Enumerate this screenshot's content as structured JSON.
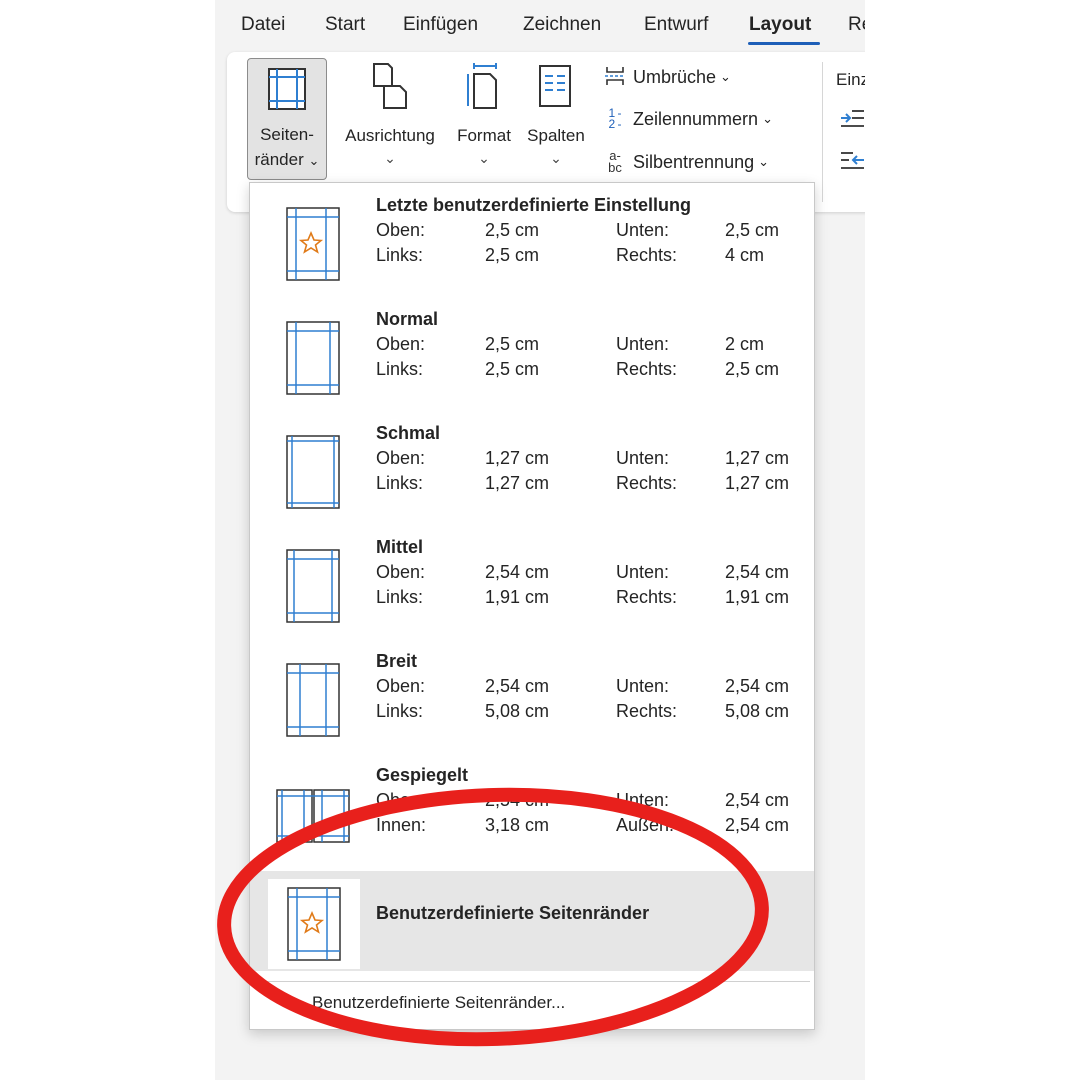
{
  "tabs": [
    "Datei",
    "Start",
    "Einfügen",
    "Zeichnen",
    "Entwurf",
    "Layout",
    "Re"
  ],
  "ribbon": {
    "seiten_line1": "Seiten-",
    "seiten_line2": "ränder",
    "ausrichtung": "Ausrichtung",
    "format": "Format",
    "spalten": "Spalten",
    "umbrueche": "Umbrüche",
    "zeilennummern": "Zeilennummern",
    "silbentrennung": "Silbentrennung",
    "einzug_fragment": "Einz",
    "chevron": "⌄",
    "zeilen_icon": "1 -\n2 -",
    "silben_icon_a": "a-",
    "silben_icon_bc": "bc"
  },
  "presets": [
    {
      "title": "Letzte benutzerdefinierte Einstellung",
      "l1": "Oben:",
      "v1": "2,5 cm",
      "l2": "Unten:",
      "v2": "2,5 cm",
      "l3": "Links:",
      "v3": "2,5 cm",
      "l4": "Rechts:",
      "v4": "4 cm"
    },
    {
      "title": "Normal",
      "l1": "Oben:",
      "v1": "2,5 cm",
      "l2": "Unten:",
      "v2": "2 cm",
      "l3": "Links:",
      "v3": "2,5 cm",
      "l4": "Rechts:",
      "v4": "2,5 cm"
    },
    {
      "title": "Schmal",
      "l1": "Oben:",
      "v1": "1,27 cm",
      "l2": "Unten:",
      "v2": "1,27 cm",
      "l3": "Links:",
      "v3": "1,27 cm",
      "l4": "Rechts:",
      "v4": "1,27 cm"
    },
    {
      "title": "Mittel",
      "l1": "Oben:",
      "v1": "2,54 cm",
      "l2": "Unten:",
      "v2": "2,54 cm",
      "l3": "Links:",
      "v3": "1,91 cm",
      "l4": "Rechts:",
      "v4": "1,91 cm"
    },
    {
      "title": "Breit",
      "l1": "Oben:",
      "v1": "2,54 cm",
      "l2": "Unten:",
      "v2": "2,54 cm",
      "l3": "Links:",
      "v3": "5,08 cm",
      "l4": "Rechts:",
      "v4": "5,08 cm"
    },
    {
      "title": "Gespiegelt",
      "l1": "Oben:",
      "v1": "2,54 cm",
      "l2": "Unten:",
      "v2": "2,54 cm",
      "l3": "Innen:",
      "v3": "3,18 cm",
      "l4": "Außen:",
      "v4": "2,54 cm"
    }
  ],
  "custom_title": "Benutzerdefinierte Seitenränder",
  "custom_link": "Benutzerdefinierte Seitenränder...",
  "colors": {
    "accent": "#1e5fb8",
    "margin_line": "#2f7fd1",
    "star": "#e07b1a",
    "annotation": "#e8201c"
  }
}
